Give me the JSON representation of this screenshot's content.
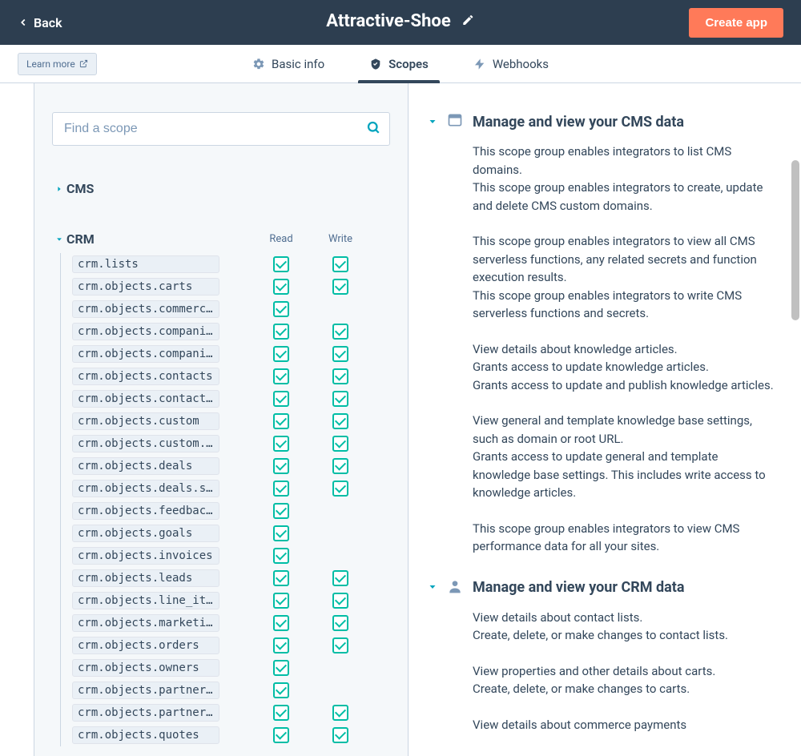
{
  "header": {
    "back_label": "Back",
    "app_title": "Attractive-Shoe",
    "create_label": "Create app"
  },
  "tabbar": {
    "learn_more": "Learn more",
    "tabs": {
      "basic": "Basic info",
      "scopes": "Scopes",
      "webhooks": "Webhooks"
    }
  },
  "search": {
    "placeholder": "Find a scope"
  },
  "categories": {
    "cms": "CMS",
    "crm": "CRM"
  },
  "columns": {
    "read": "Read",
    "write": "Write"
  },
  "scopes": [
    {
      "name": "crm.lists",
      "read": true,
      "write": true
    },
    {
      "name": "crm.objects.carts",
      "read": true,
      "write": true
    },
    {
      "name": "crm.objects.commerc…",
      "read": true,
      "write": null
    },
    {
      "name": "crm.objects.compani…",
      "read": true,
      "write": true
    },
    {
      "name": "crm.objects.compani…",
      "read": true,
      "write": true
    },
    {
      "name": "crm.objects.contacts",
      "read": true,
      "write": true
    },
    {
      "name": "crm.objects.contact…",
      "read": true,
      "write": true
    },
    {
      "name": "crm.objects.custom",
      "read": true,
      "write": true
    },
    {
      "name": "crm.objects.custom.…",
      "read": true,
      "write": true
    },
    {
      "name": "crm.objects.deals",
      "read": true,
      "write": true
    },
    {
      "name": "crm.objects.deals.s…",
      "read": true,
      "write": true
    },
    {
      "name": "crm.objects.feedbac…",
      "read": true,
      "write": null
    },
    {
      "name": "crm.objects.goals",
      "read": true,
      "write": null
    },
    {
      "name": "crm.objects.invoices",
      "read": true,
      "write": null
    },
    {
      "name": "crm.objects.leads",
      "read": true,
      "write": true
    },
    {
      "name": "crm.objects.line_it…",
      "read": true,
      "write": true
    },
    {
      "name": "crm.objects.marketi…",
      "read": true,
      "write": true
    },
    {
      "name": "crm.objects.orders",
      "read": true,
      "write": true
    },
    {
      "name": "crm.objects.owners",
      "read": true,
      "write": null
    },
    {
      "name": "crm.objects.partner…",
      "read": true,
      "write": null
    },
    {
      "name": "crm.objects.partner…",
      "read": true,
      "write": true
    },
    {
      "name": "crm.objects.quotes",
      "read": true,
      "write": true
    }
  ],
  "right": {
    "cms": {
      "title": "Manage and view your CMS data",
      "p1": "This scope group enables integrators to list CMS domains.\nThis scope group enables integrators to create, update and delete CMS custom domains.",
      "p2": "This scope group enables integrators to view all CMS serverless functions, any related secrets and function execution results.\nThis scope group enables integrators to write CMS serverless functions and secrets.",
      "p3": "View details about knowledge articles.\nGrants access to update knowledge articles.\nGrants access to update and publish knowledge articles.",
      "p4": "View general and template knowledge base settings, such as domain or root URL.\nGrants access to update general and template knowledge base settings. This includes write access to knowledge articles.",
      "p5": "This scope group enables integrators to view CMS performance data for all your sites."
    },
    "crm": {
      "title": "Manage and view your CRM data",
      "p1": "View details about contact lists.\nCreate, delete, or make changes to contact lists.",
      "p2": "View properties and other details about carts.\nCreate, delete, or make changes to carts.",
      "p3": "View details about commerce payments"
    }
  }
}
